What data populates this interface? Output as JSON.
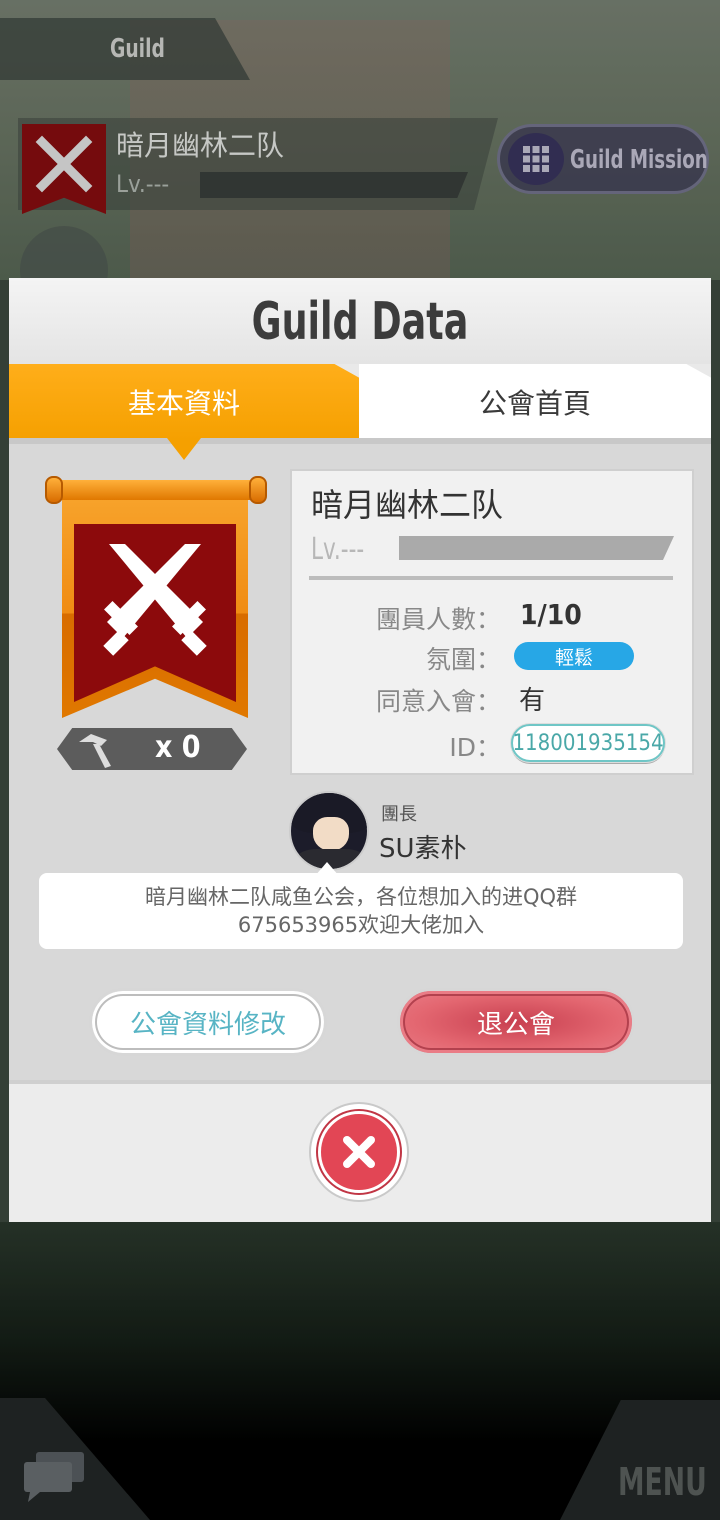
{
  "background": {
    "guild_tab_title": "Guild",
    "guild_name": "暗月幽林二队",
    "guild_level": "Lv.---",
    "guild_mission_label": "Guild Mission",
    "menu_label": "MENU"
  },
  "modal": {
    "title": "Guild Data",
    "tabs": [
      {
        "label": "基本資料",
        "active": true
      },
      {
        "label": "公會首頁",
        "active": false
      }
    ],
    "hammer_count": "x 0",
    "info": {
      "name": "暗月幽林二队",
      "level": "Lv.---",
      "members_label": "團員人數：",
      "members_value": "1/10",
      "atmosphere_label": "氛圍：",
      "atmosphere_value": "輕鬆",
      "approval_label": "同意入會：",
      "approval_value": "有",
      "id_label": "ID：",
      "id_value": "118001935154"
    },
    "leader": {
      "role": "團長",
      "name": "SU素朴"
    },
    "description": {
      "line1": "暗月幽林二队咸鱼公会，各位想加入的进QQ群",
      "line2": "675653965欢迎大佬加入"
    },
    "buttons": {
      "edit_label": "公會資料修改",
      "leave_label": "退公會"
    }
  },
  "colors": {
    "accent_orange": "#f5a000",
    "emblem_red": "#8c0a0c",
    "atmosphere_blue": "#27a7e6",
    "leave_red": "#e24655",
    "id_teal": "#4aa8a8"
  },
  "icons": [
    "swords-icon",
    "hammer-icon",
    "close-icon",
    "chat-icon",
    "grid-icon",
    "menu-list-icon"
  ]
}
